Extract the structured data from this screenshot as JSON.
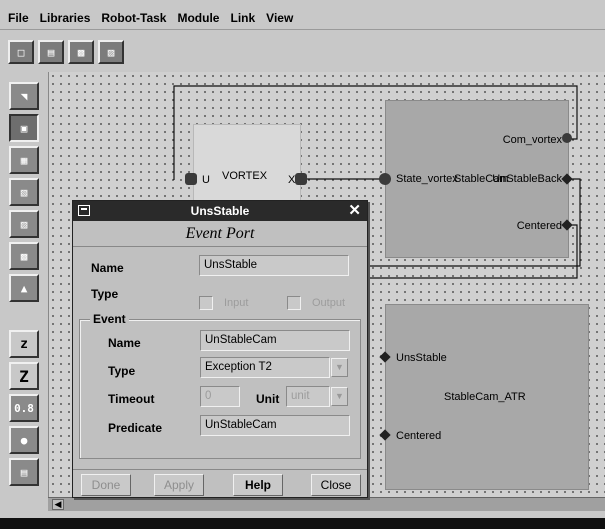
{
  "menu": [
    "File",
    "Libraries",
    "Robot-Task",
    "Module",
    "Link",
    "View"
  ],
  "toolbar_icons": [
    "open-icon",
    "save-icon",
    "save-as-icon",
    "export-icon"
  ],
  "palette_icons": [
    "select-icon",
    "module-icon",
    "library-icon",
    "link-icon",
    "task-icon",
    "event-icon",
    "robot-icon"
  ],
  "zoom": {
    "zoom_out": "z",
    "zoom_in": "Z",
    "zoom_level": "0.8"
  },
  "canvas": {
    "vortex": {
      "name": "VORTEX",
      "port_in": "U",
      "port_out": "X"
    },
    "stablecam": {
      "name": "StableCam",
      "port_in": "State_vortex",
      "out_com": "Com_vortex",
      "out_unstable": "UnStableBack",
      "out_centered": "Centered"
    },
    "stablecam_atr": {
      "name": "StableCam_ATR",
      "in_unstable": "UnsStable",
      "in_centered": "Centered"
    }
  },
  "dialog": {
    "title": "UnsStable",
    "subtitle": "Event Port",
    "name_label": "Name",
    "name_value": "UnsStable",
    "type_label": "Type",
    "input_label": "Input",
    "output_label": "Output",
    "event": {
      "legend": "Event",
      "name_label": "Name",
      "name_value": "UnStableCam",
      "type_label": "Type",
      "type_value": "Exception T2",
      "timeout_label": "Timeout",
      "timeout_value": "0",
      "unit_label": "Unit",
      "unit_value": "unit",
      "predicate_label": "Predicate",
      "predicate_value": "UnStableCam"
    },
    "buttons": {
      "done": "Done",
      "apply": "Apply",
      "help": "Help",
      "close": "Close"
    }
  }
}
